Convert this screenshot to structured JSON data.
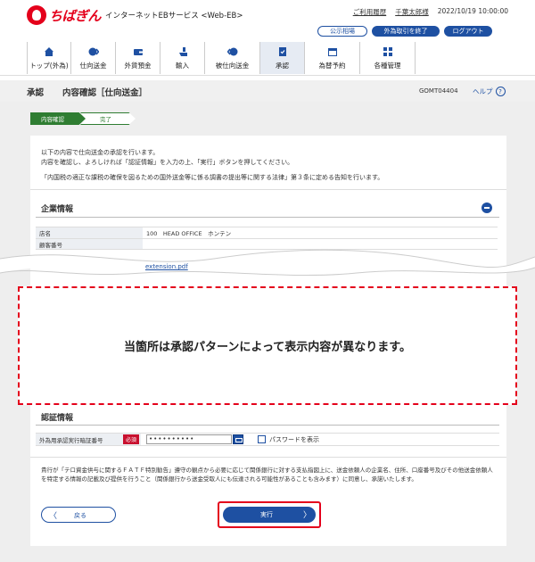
{
  "header": {
    "brand": "ちばぎん",
    "service": "インターネットEBサービス <Web-EB>",
    "links": [
      "ご利用履歴",
      "千葉太郎様",
      "2022/10/19 10:00:00"
    ],
    "buttons": [
      "公示相場",
      "外為取引を終了",
      "ログアウト"
    ]
  },
  "nav": {
    "items": [
      {
        "label": "トップ(外為)",
        "icon": "house-icon"
      },
      {
        "label": "仕向送金",
        "icon": "send-money-icon"
      },
      {
        "label": "外貨預金",
        "icon": "wallet-icon"
      },
      {
        "label": "輸入",
        "icon": "import-icon"
      },
      {
        "label": "被仕向送金",
        "icon": "receive-money-icon"
      },
      {
        "label": "承認",
        "icon": "approval-icon"
      },
      {
        "label": "為替予約",
        "icon": "calendar-icon"
      },
      {
        "label": "各種管理",
        "icon": "grid-icon"
      }
    ],
    "active_index": 5
  },
  "title": {
    "main": "承認",
    "sub": "内容確認［仕向送金］",
    "screen_id": "GOMT04404",
    "help": "ヘルプ"
  },
  "steps": [
    "内容確認",
    "完了"
  ],
  "intro": {
    "line1": "以下の内容で仕向送金の承認を行います。",
    "line2": "内容を確認し、よろしければ「認証情報」を入力の上、「実行」ボタンを押してください。",
    "notice": "「内国税の適正な課税の確保を図るための国外送金等に係る調書の提出等に関する法律」第３条に定める告知を行います。"
  },
  "company": {
    "title": "企業情報",
    "rows": [
      {
        "label": "店名",
        "value": "100　HEAD OFFICE　ホンテン"
      },
      {
        "label": "顧客番号",
        "value": ""
      }
    ],
    "attachment": "extension.pdf"
  },
  "dashed_notice": "当箇所は承認パターンによって表示内容が異なります。",
  "auth": {
    "title": "認証情報",
    "label": "外為用承認実行暗証番号",
    "required": "必須",
    "password_value": "••••••••••",
    "show_password_label": "パスワードを表示"
  },
  "consent": "貴行が「テロ資金供与に関するＦＡＴＦ特別勧告」遵守の観点から必要に応じて関係銀行に対する支払指図上に、送金依頼人の企業名、住所、口座番号及びその他送金依頼人を特定する情報の記載及び提供を行うこと（関係銀行から送金受取人にも伝達される可能性があることも含みます）に同意し、承諾いたします。",
  "actions": {
    "back": "戻る",
    "execute": "実行"
  }
}
